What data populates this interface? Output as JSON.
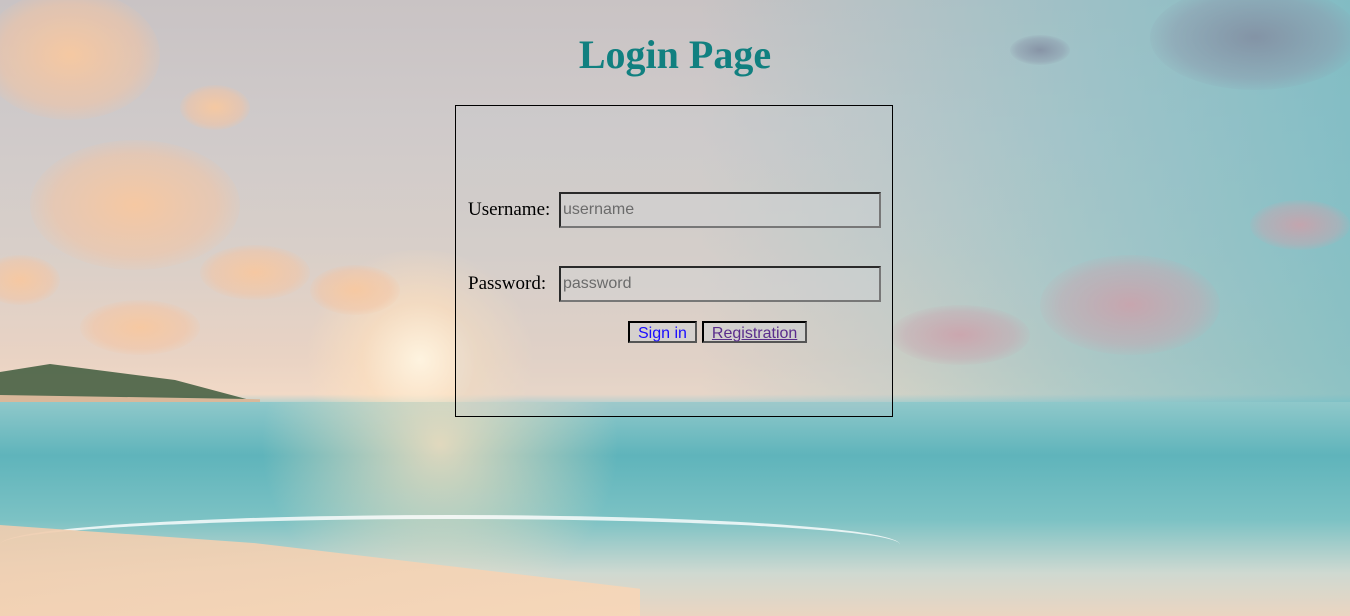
{
  "page": {
    "title": "Login Page"
  },
  "form": {
    "username_label": "Username:",
    "username_placeholder": "username",
    "username_value": "",
    "password_label": "Password:",
    "password_placeholder": "password",
    "password_value": "",
    "signin_label": "Sign in",
    "registration_label": "Registration"
  },
  "colors": {
    "title": "#118080",
    "signin_text": "#1a0dff",
    "registration_link": "#5a2d8c"
  }
}
